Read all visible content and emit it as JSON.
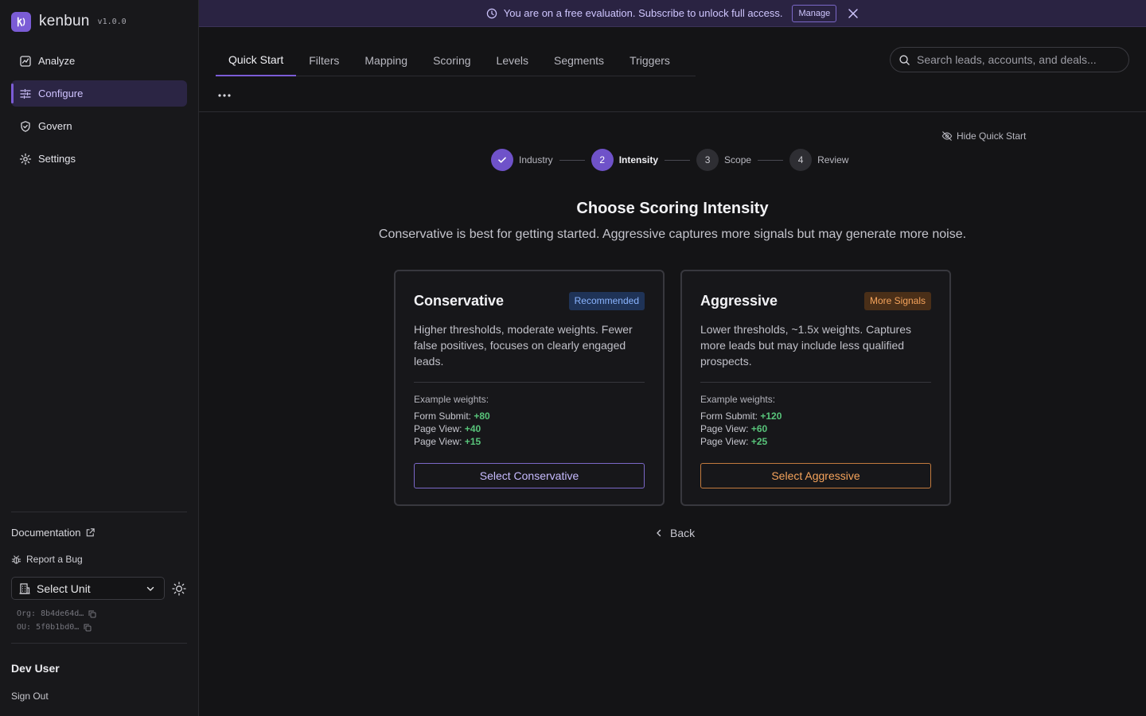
{
  "brand": {
    "name": "kenbun",
    "version": "v1.0.0",
    "logo_letter": "k",
    "accent": "#7b5cd6"
  },
  "sidebar": {
    "items": [
      {
        "label": "Analyze",
        "icon": "chart-icon"
      },
      {
        "label": "Configure",
        "icon": "sliders-icon",
        "active": true
      },
      {
        "label": "Govern",
        "icon": "shield-icon"
      },
      {
        "label": "Settings",
        "icon": "gear-icon"
      }
    ],
    "documentation": "Documentation",
    "report_bug": "Report a Bug",
    "unit_select": "Select Unit",
    "org_id": "Org: 8b4de64d…",
    "ou_id": "OU: 5f0b1bd0…",
    "user_name": "Dev User",
    "sign_out": "Sign Out"
  },
  "banner": {
    "text": "You are on a free evaluation. Subscribe to unlock full access.",
    "manage_label": "Manage"
  },
  "tabs": [
    {
      "label": "Quick Start",
      "active": true
    },
    {
      "label": "Filters"
    },
    {
      "label": "Mapping"
    },
    {
      "label": "Scoring"
    },
    {
      "label": "Levels"
    },
    {
      "label": "Segments"
    },
    {
      "label": "Triggers"
    }
  ],
  "search": {
    "placeholder": "Search leads, accounts, and deals..."
  },
  "quick_start": {
    "hide_label": "Hide Quick Start",
    "steps": [
      {
        "number": "1",
        "label": "Industry",
        "status": "done"
      },
      {
        "number": "2",
        "label": "Intensity",
        "status": "current"
      },
      {
        "number": "3",
        "label": "Scope",
        "status": "pending"
      },
      {
        "number": "4",
        "label": "Review",
        "status": "pending"
      }
    ],
    "title": "Choose Scoring Intensity",
    "subtitle": "Conservative is best for getting started. Aggressive captures more signals but may generate more noise.",
    "cards": [
      {
        "title": "Conservative",
        "badge": "Recommended",
        "description": "Higher thresholds, moderate weights. Fewer false positives, focuses on clearly engaged leads.",
        "weights_label": "Example weights:",
        "weights": [
          {
            "label": "Form Submit:",
            "value": "+80"
          },
          {
            "label": "Page View:",
            "value": "+40"
          },
          {
            "label": "Page View:",
            "value": "+15"
          }
        ],
        "button": "Select Conservative"
      },
      {
        "title": "Aggressive",
        "badge": "More Signals",
        "description": "Lower thresholds, ~1.5x weights. Captures more leads but may include less qualified prospects.",
        "weights_label": "Example weights:",
        "weights": [
          {
            "label": "Form Submit:",
            "value": "+120"
          },
          {
            "label": "Page View:",
            "value": "+60"
          },
          {
            "label": "Page View:",
            "value": "+25"
          }
        ],
        "button": "Select Aggressive"
      }
    ],
    "back_label": "Back"
  },
  "colors": {
    "positive": "#58c47a",
    "recommended": "#8ab4ff",
    "signals": "#f5a35b",
    "background": "#141416"
  }
}
